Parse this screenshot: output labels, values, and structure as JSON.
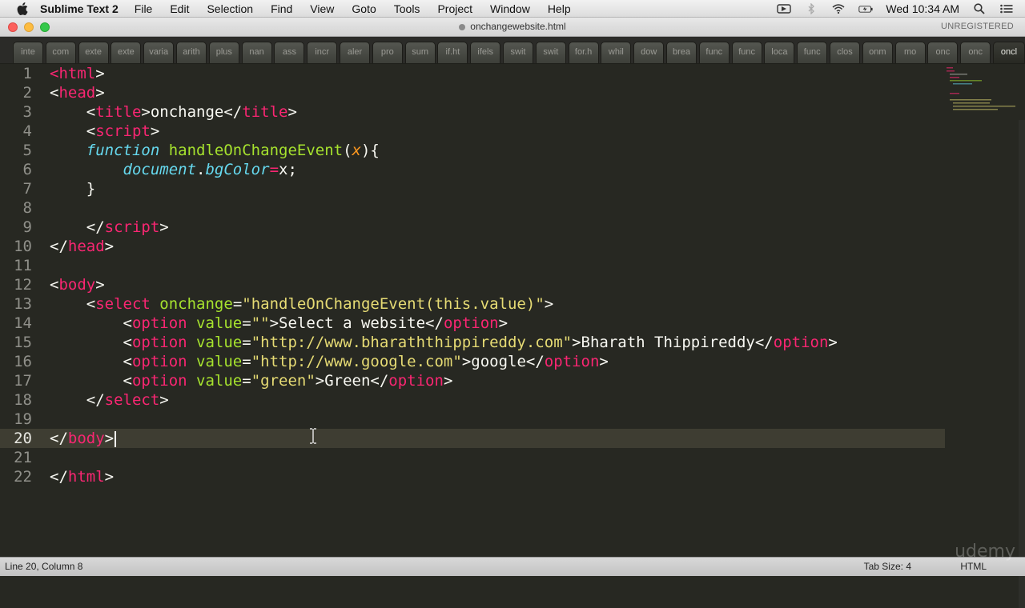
{
  "menubar": {
    "app_name": "Sublime Text 2",
    "items": [
      "File",
      "Edit",
      "Selection",
      "Find",
      "View",
      "Goto",
      "Tools",
      "Project",
      "Window",
      "Help"
    ],
    "clock": "Wed 10:34 AM",
    "tray_icons": [
      "camera-icon",
      "bluetooth-icon",
      "wifi-icon",
      "battery-icon",
      "spotlight-icon",
      "list-icon"
    ]
  },
  "window": {
    "title": "onchangewebsite.html",
    "registration": "UNREGISTERED"
  },
  "tabs": [
    "inte",
    "com",
    "exte",
    "exte",
    "varia",
    "arith",
    "plus",
    "nan",
    "ass",
    "incr",
    "aler",
    "pro",
    "sum",
    "if.ht",
    "ifels",
    "swit",
    "swit",
    "for.h",
    "whil",
    "dow",
    "brea",
    "func",
    "func",
    "loca",
    "func",
    "clos",
    "onm",
    "mo",
    "onc",
    "onc",
    "oncl"
  ],
  "active_tab_index": 30,
  "editor": {
    "line_numbers": [
      "1",
      "2",
      "3",
      "4",
      "5",
      "6",
      "7",
      "8",
      "9",
      "10",
      "11",
      "12",
      "13",
      "14",
      "15",
      "16",
      "17",
      "18",
      "19",
      "20",
      "21",
      "22"
    ],
    "current_line": 20
  },
  "code": [
    [
      [
        "tg",
        "<"
      ],
      [
        "tg",
        "html"
      ],
      [
        "tx",
        ">"
      ]
    ],
    [
      [
        "tx",
        "<"
      ],
      [
        "tg",
        "head"
      ],
      [
        "tx",
        ">"
      ]
    ],
    [
      [
        "tx",
        "    <"
      ],
      [
        "tg",
        "title"
      ],
      [
        "tx",
        ">onchange</"
      ],
      [
        "tg",
        "title"
      ],
      [
        "tx",
        ">"
      ]
    ],
    [
      [
        "tx",
        "    <"
      ],
      [
        "tg",
        "script"
      ],
      [
        "tx",
        ">"
      ]
    ],
    [
      [
        "kw",
        "    function"
      ],
      [
        "tx",
        " "
      ],
      [
        "fn",
        "handleOnChangeEvent"
      ],
      [
        "tx",
        "("
      ],
      [
        "pa",
        "x"
      ],
      [
        "tx",
        "){"
      ]
    ],
    [
      [
        "tx",
        "        "
      ],
      [
        "kw",
        "document"
      ],
      [
        "tx",
        "."
      ],
      [
        "kw",
        "bgColor"
      ],
      [
        "op",
        "="
      ],
      [
        "tx",
        "x;"
      ]
    ],
    [
      [
        "tx",
        "    }"
      ]
    ],
    [
      [
        "tx",
        ""
      ]
    ],
    [
      [
        "tx",
        "    </"
      ],
      [
        "tg",
        "script"
      ],
      [
        "tx",
        ">"
      ]
    ],
    [
      [
        "tx",
        "</"
      ],
      [
        "tg",
        "head"
      ],
      [
        "tx",
        ">"
      ]
    ],
    [
      [
        "tx",
        ""
      ]
    ],
    [
      [
        "tx",
        "<"
      ],
      [
        "tg",
        "body"
      ],
      [
        "tx",
        ">"
      ]
    ],
    [
      [
        "tx",
        "    <"
      ],
      [
        "tg",
        "select"
      ],
      [
        "tx",
        " "
      ],
      [
        "at",
        "onchange"
      ],
      [
        "tx",
        "="
      ],
      [
        "st",
        "\"handleOnChangeEvent(this.value)\""
      ],
      [
        "tx",
        ">"
      ]
    ],
    [
      [
        "tx",
        "        <"
      ],
      [
        "tg",
        "option"
      ],
      [
        "tx",
        " "
      ],
      [
        "at",
        "value"
      ],
      [
        "tx",
        "="
      ],
      [
        "st",
        "\"\""
      ],
      [
        "tx",
        ">Select a website</"
      ],
      [
        "tg",
        "option"
      ],
      [
        "tx",
        ">"
      ]
    ],
    [
      [
        "tx",
        "        <"
      ],
      [
        "tg",
        "option"
      ],
      [
        "tx",
        " "
      ],
      [
        "at",
        "value"
      ],
      [
        "tx",
        "="
      ],
      [
        "st",
        "\"http://www.bharaththippireddy.com\""
      ],
      [
        "tx",
        ">Bharath Thippireddy</"
      ],
      [
        "tg",
        "option"
      ],
      [
        "tx",
        ">"
      ]
    ],
    [
      [
        "tx",
        "        <"
      ],
      [
        "tg",
        "option"
      ],
      [
        "tx",
        " "
      ],
      [
        "at",
        "value"
      ],
      [
        "tx",
        "="
      ],
      [
        "st",
        "\"http://www.google.com\""
      ],
      [
        "tx",
        ">google</"
      ],
      [
        "tg",
        "option"
      ],
      [
        "tx",
        ">"
      ]
    ],
    [
      [
        "tx",
        "        <"
      ],
      [
        "tg",
        "option"
      ],
      [
        "tx",
        " "
      ],
      [
        "at",
        "value"
      ],
      [
        "tx",
        "="
      ],
      [
        "st",
        "\"green\""
      ],
      [
        "tx",
        ">Green</"
      ],
      [
        "tg",
        "option"
      ],
      [
        "tx",
        ">"
      ]
    ],
    [
      [
        "tx",
        "    </"
      ],
      [
        "tg",
        "select"
      ],
      [
        "tx",
        ">"
      ]
    ],
    [
      [
        "tx",
        ""
      ]
    ],
    [
      [
        "tx",
        "</"
      ],
      [
        "tg",
        "body"
      ],
      [
        "tx",
        ">"
      ]
    ],
    [
      [
        "tx",
        ""
      ]
    ],
    [
      [
        "tx",
        "</"
      ],
      [
        "tg",
        "html"
      ],
      [
        "tx",
        ">"
      ]
    ]
  ],
  "statusbar": {
    "position": "Line 20, Column 8",
    "tab_size": "Tab Size: 4",
    "syntax": "HTML"
  },
  "watermark": "udemy",
  "colors": {
    "background": "#272822",
    "tag": "#f92672",
    "attribute": "#a6e22e",
    "string": "#e6db74",
    "keyword": "#66d9ef",
    "param": "#fd971f",
    "text": "#f8f8f2"
  }
}
